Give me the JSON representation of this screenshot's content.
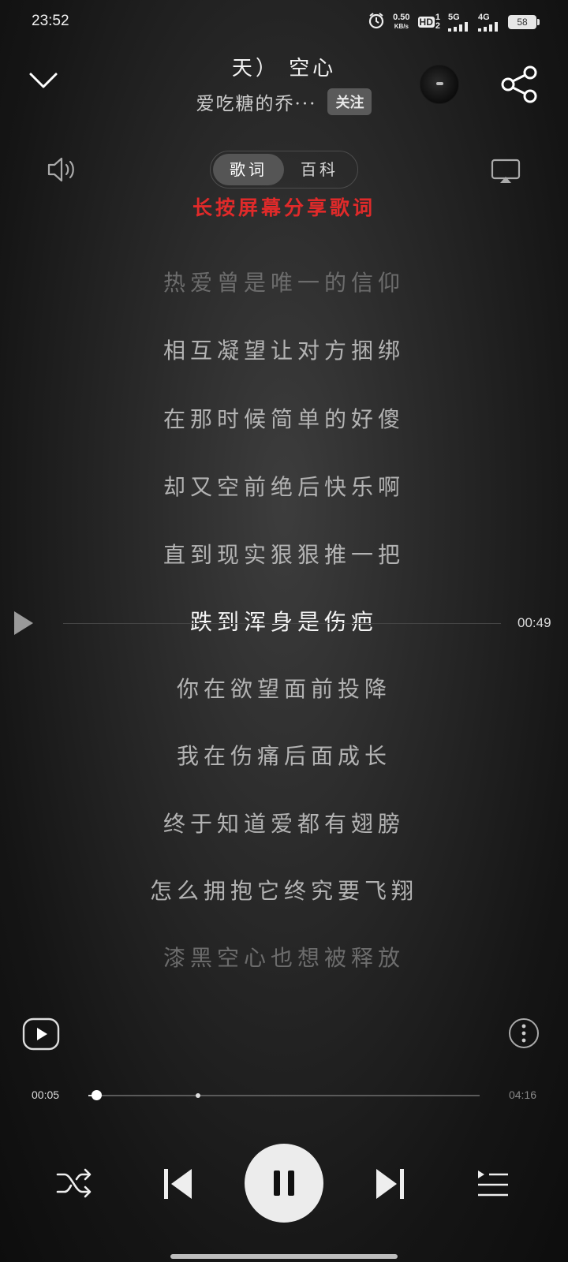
{
  "status_bar": {
    "time": "23:52",
    "net_speed_value": "0.50",
    "net_speed_unit": "KB/s",
    "hd_label": "HD",
    "sim1": "1",
    "sim2": "2",
    "network1": "5G",
    "network2": "4G",
    "battery": "58"
  },
  "header": {
    "title": "天）        空心",
    "artist": "爱吃糖的乔···",
    "follow_label": "关注"
  },
  "tabs": [
    {
      "label": "歌词",
      "active": true
    },
    {
      "label": "百科",
      "active": false
    }
  ],
  "hint": "长按屏幕分享歌词",
  "lyrics": [
    {
      "text": "热爱曾是唯一的信仰",
      "state": "faint"
    },
    {
      "text": "相互凝望让对方捆绑",
      "state": "normal"
    },
    {
      "text": "在那时候简单的好傻",
      "state": "normal"
    },
    {
      "text": "却又空前绝后快乐啊",
      "state": "normal"
    },
    {
      "text": "直到现实狠狠推一把",
      "state": "normal"
    },
    {
      "text": "跌到浑身是伤疤",
      "state": "current"
    },
    {
      "text": "你在欲望面前投降",
      "state": "normal"
    },
    {
      "text": "我在伤痛后面成长",
      "state": "normal"
    },
    {
      "text": "终于知道爱都有翅膀",
      "state": "normal"
    },
    {
      "text": "怎么拥抱它终究要飞翔",
      "state": "normal"
    },
    {
      "text": "漆黑空心也想被释放",
      "state": "faint"
    }
  ],
  "seek_time": "00:49",
  "player": {
    "current_time": "00:05",
    "total_time": "04:16",
    "progress": 0.02,
    "buffered": 0.28
  },
  "colors": {
    "hint": "#e02a2a",
    "button_bg": "#ececec"
  }
}
